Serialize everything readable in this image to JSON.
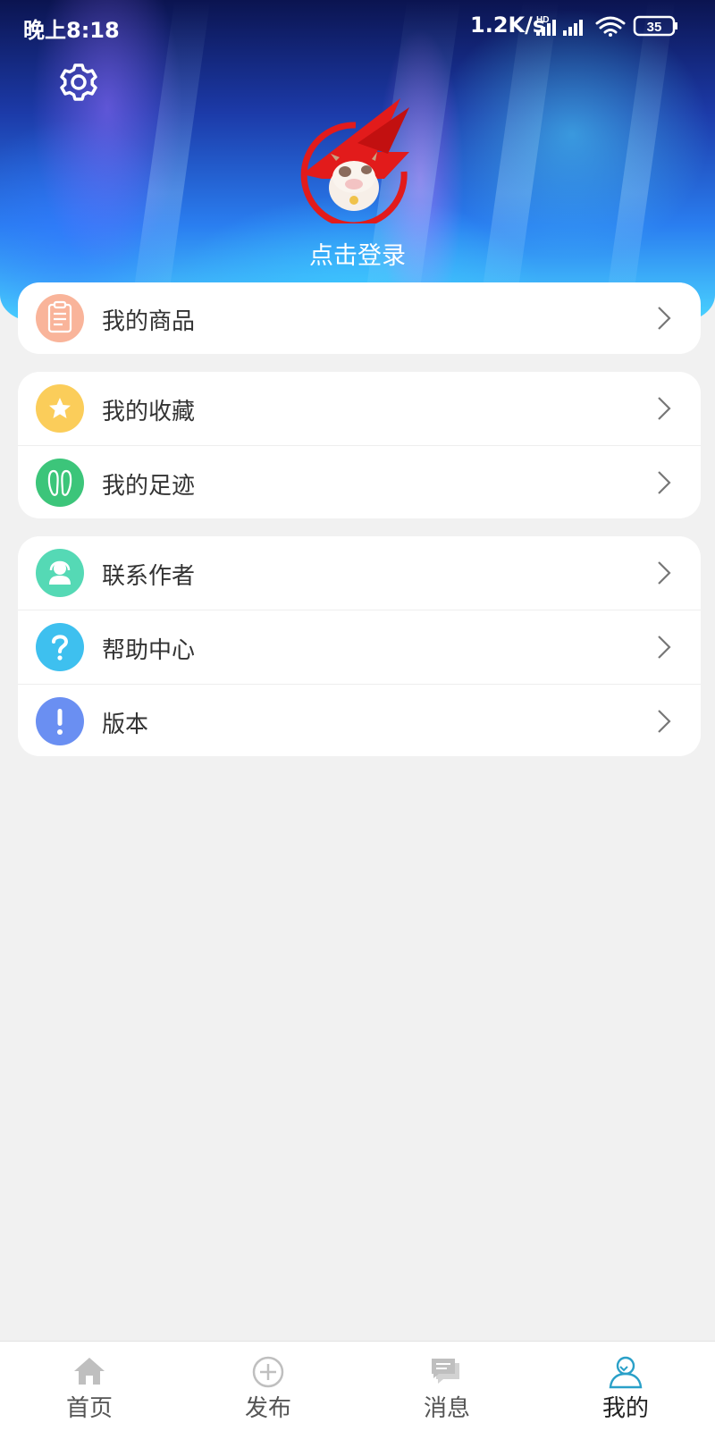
{
  "status_bar": {
    "time": "晚上8:18",
    "speed": "1.2K/s",
    "battery": "35"
  },
  "header": {
    "login_text": "点击登录"
  },
  "menu_groups": [
    {
      "items": [
        {
          "label": "我的商品",
          "icon": "product-list-icon",
          "color": "#f9b49a"
        }
      ]
    },
    {
      "items": [
        {
          "label": "我的收藏",
          "icon": "star-icon",
          "color": "#fbcd5a"
        },
        {
          "label": "我的足迹",
          "icon": "footprint-icon",
          "color": "#3cc57a"
        }
      ]
    },
    {
      "items": [
        {
          "label": "联系作者",
          "icon": "contact-author-icon",
          "color": "#55d9b5"
        },
        {
          "label": "帮助中心",
          "icon": "question-icon",
          "color": "#3ec0ef"
        },
        {
          "label": "版本",
          "icon": "exclamation-icon",
          "color": "#6a8ff2"
        }
      ]
    }
  ],
  "bottom_nav": [
    {
      "label": "首页",
      "icon": "home-icon",
      "active": false
    },
    {
      "label": "发布",
      "icon": "plus-circle-icon",
      "active": false
    },
    {
      "label": "消息",
      "icon": "message-icon",
      "active": false
    },
    {
      "label": "我的",
      "icon": "profile-icon",
      "active": true
    }
  ],
  "colors": {
    "active_tab_icon": "#2aa0c8",
    "inactive_tab_icon": "#bfbfbf"
  }
}
